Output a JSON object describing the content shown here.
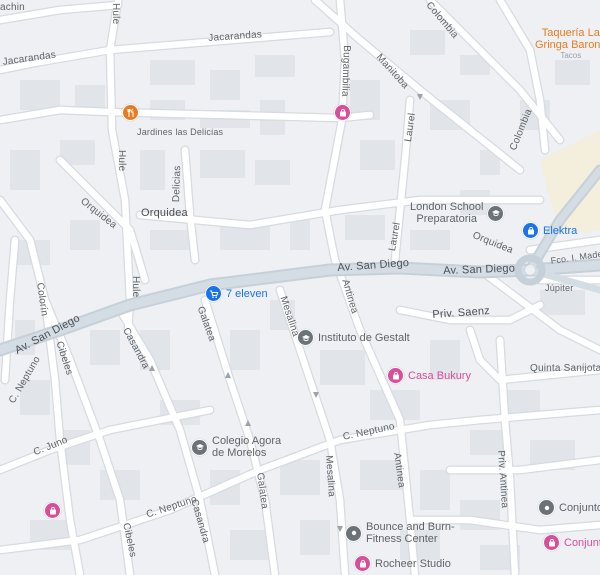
{
  "colors": {
    "background": "#eef0f3",
    "road": "#ffffff",
    "main_road": "#c9d3dc",
    "road_casing": "#d7dde3",
    "block": "#dfe2e6",
    "shopping": "#d94d9a",
    "education": "#6b7378",
    "store": "#1a73e8",
    "food": "#e67c22",
    "label_gray": "#5f6368",
    "label_pink": "#d94d9a",
    "label_blue": "#1a73e8",
    "label_orange": "#e67c22"
  },
  "streets": {
    "jacarandas_top": "Jacarandas",
    "jacarandas_left": "Jacarandas",
    "hule_top": "Hule",
    "hule_mid": "Hule",
    "hule_low": "Hule",
    "bugambilia": "Bugambilia",
    "manitoba": "Manitoba",
    "colombia_top": "Colombia",
    "colombia_mid": "Colombia",
    "laurel_top": "Laurel",
    "laurel_mid": "Laurel",
    "delicias": "Delicias",
    "orquidea_left": "Orquidea",
    "orquidea_main": "Orquidea",
    "orquidea_right": "Orquidea",
    "av_san_diego_left": "Av. San Diego",
    "av_san_diego_mid": "Av. San Diego",
    "av_san_diego_right": "Av. San Diego",
    "fco_madero": "Fco. I. Madero",
    "jupiter": "Júpiter",
    "antinea_top": "Antinea",
    "antinea_low": "Antinea",
    "priv_saenz": "Priv. Saenz",
    "quinta_sanijota": "Quinta Sanijota",
    "priv_antinea": "Priv. Antinea",
    "colorin": "Colorín",
    "cibeles_top": "Cibeles",
    "cibeles_low": "Cibeles",
    "casandra_top": "Casandra",
    "casandra_low": "Casandra",
    "galatea_top": "Galatea",
    "galatea_low": "Galatea",
    "mesalina_top": "Mesalina",
    "mesalina_low": "Mesalina",
    "c_neptuno_left": "C. Neptuno",
    "c_neptuno_low": "C. Neptuno",
    "c_neptuno_right": "C. Neptuno",
    "c_juno": "C. Juno",
    "achin": "achin"
  },
  "pois": {
    "taqueria": {
      "name_line1": "Taquería La",
      "name_line2": "Gringa Barona",
      "category": "Tacos",
      "icon": "food-icon"
    },
    "jardines": {
      "name": "Jardines las Delicias",
      "icon": "fork-knife-icon"
    },
    "london_school": {
      "name_line1": "London School",
      "name_line2": "Preparatoria",
      "icon": "school-icon"
    },
    "elektra": {
      "name": "Elektra",
      "icon": "shopping-bag-icon"
    },
    "seven_eleven": {
      "name": "7 eleven",
      "icon": "shopping-cart-icon"
    },
    "instituto_gestalt": {
      "name": "Instituto de Gestalt",
      "icon": "school-icon"
    },
    "casa_bukury": {
      "name": "Casa Bukury",
      "icon": "shopping-bag-icon"
    },
    "colegio_agora": {
      "name_line1": "Colegio Agora",
      "name_line2": "de Morelos",
      "icon": "school-icon"
    },
    "bounce_burn": {
      "name_line1": "Bounce and Burn-",
      "name_line2": "Fitness Center",
      "icon": "dot-icon"
    },
    "rocheer": {
      "name": "Rocheer Studio",
      "icon": "shopping-bag-icon"
    },
    "conjunto_1": {
      "name": "Conjunto",
      "icon": "dot-icon"
    },
    "conjunto_2": {
      "name": "Conjunto",
      "icon": "shopping-bag-icon"
    },
    "bugambilia_shop": {
      "icon": "shopping-bag-icon"
    },
    "left_shop": {
      "icon": "shopping-bag-icon"
    }
  }
}
